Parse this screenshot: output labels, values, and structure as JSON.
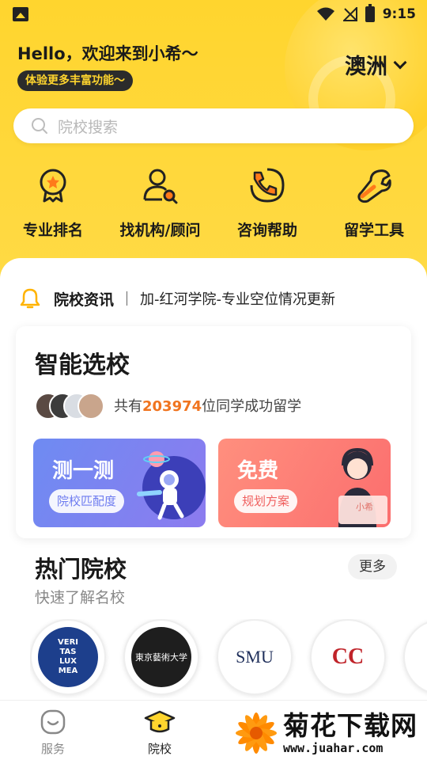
{
  "status_bar": {
    "time": "9:15"
  },
  "header": {
    "greeting": "Hello，欢迎来到小希～",
    "badge": "体验更多丰富功能～",
    "region": "澳洲"
  },
  "search": {
    "placeholder": "院校搜索"
  },
  "quick_nav": [
    {
      "label": "专业排名",
      "icon": "medal-icon"
    },
    {
      "label": "找机构/顾问",
      "icon": "person-search-icon"
    },
    {
      "label": "咨询帮助",
      "icon": "phone-chat-icon"
    },
    {
      "label": "留学工具",
      "icon": "wrench-icon"
    }
  ],
  "news": {
    "title": "院校资讯",
    "text": "加-红河学院-专业空位情况更新"
  },
  "smart_select": {
    "title": "智能选校",
    "stat_prefix": "共有",
    "stat_count": "203974",
    "stat_suffix": "位同学成功留学",
    "promo_test": {
      "title": "测一测",
      "pill": "院校匹配度"
    },
    "promo_free": {
      "title": "免费",
      "pill": "规划方案",
      "tag": "小希"
    }
  },
  "hot_schools": {
    "title": "热门院校",
    "subtitle": "快速了解名校",
    "more_label": "更多",
    "schools": [
      {
        "name": "veritas-crest",
        "logo_text": "VERI TAS LUX MEA"
      },
      {
        "name": "tokyo-arts",
        "logo_text": "東京藝術大学"
      },
      {
        "name": "smu",
        "logo_text": "SMU"
      },
      {
        "name": "caduceus-college",
        "logo_text": "CC"
      }
    ]
  },
  "tabbar": {
    "tabs": [
      {
        "label": "服务",
        "icon": "smile-icon",
        "active": false
      },
      {
        "label": "院校",
        "icon": "graduation-cap-icon",
        "active": true
      }
    ]
  },
  "watermark": {
    "title": "菊花下载网",
    "url": "www.juahar.com"
  },
  "colors": {
    "brand_yellow": "#FFD52E",
    "accent_orange": "#F0741F",
    "promo_blue": "#6E8BF2",
    "promo_red": "#FB6E6E"
  }
}
